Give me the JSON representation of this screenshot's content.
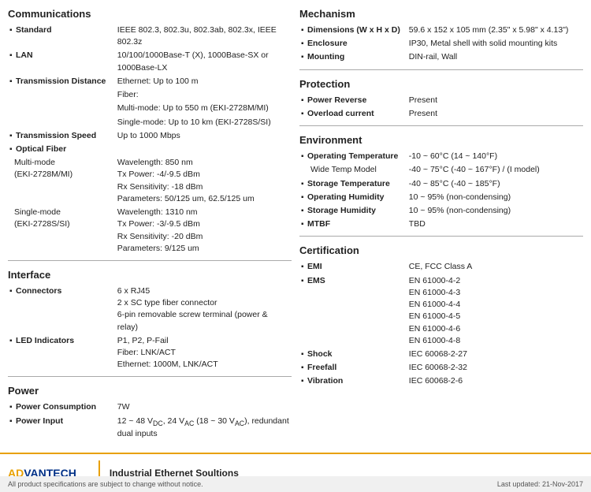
{
  "left": {
    "sections": [
      {
        "title": "Communications",
        "rows": [
          {
            "label": "Standard",
            "bold": true,
            "value": "IEEE 802.3, 802.3u, 802.3ab, 802.3x, IEEE 802.3z",
            "indent": 0
          },
          {
            "label": "LAN",
            "bold": true,
            "value": "10/100/1000Base-T (X), 1000Base-SX or 1000Base-LX",
            "indent": 0
          },
          {
            "label": "Transmission Distance",
            "bold": true,
            "value": "Ethernet: Up to 100 m",
            "indent": 0
          },
          {
            "label": "",
            "bold": false,
            "value": "Fiber:",
            "indent": 0
          },
          {
            "label": "",
            "bold": false,
            "value": "Multi-mode: Up to 550 m (EKI-2728M/MI)",
            "indent": 0
          },
          {
            "label": "",
            "bold": false,
            "value": "Single-mode: Up to 10 km (EKI-2728S/SI)",
            "indent": 0
          },
          {
            "label": "Transmission Speed",
            "bold": true,
            "value": "Up to 1000 Mbps",
            "indent": 0
          },
          {
            "label": "Optical Fiber",
            "bold": true,
            "value": "",
            "indent": 0
          },
          {
            "label": "Multi-mode",
            "bold": false,
            "value": "Wavelength: 850 nm",
            "indent": 1
          },
          {
            "label": "(EKI-2728M/MI)",
            "bold": false,
            "value": "Tx Power: -4/-9.5 dBm",
            "indent": 1
          },
          {
            "label": "",
            "bold": false,
            "value": "Rx Sensitivity: -18 dBm",
            "indent": 1
          },
          {
            "label": "",
            "bold": false,
            "value": "Parameters: 50/125 um, 62.5/125 um",
            "indent": 1
          },
          {
            "label": "Single-mode",
            "bold": false,
            "value": "Wavelength: 1310 nm",
            "indent": 1
          },
          {
            "label": "(EKI-2728S/SI)",
            "bold": false,
            "value": "Tx Power: -3/-9.5 dBm",
            "indent": 1
          },
          {
            "label": "",
            "bold": false,
            "value": "Rx Sensitivity: -20 dBm",
            "indent": 1
          },
          {
            "label": "",
            "bold": false,
            "value": "Parameters: 9/125 um",
            "indent": 1
          }
        ]
      },
      {
        "title": "Interface",
        "rows": [
          {
            "label": "Connectors",
            "bold": true,
            "value": "6 x RJ45",
            "indent": 0
          },
          {
            "label": "",
            "bold": false,
            "value": "2 x SC type fiber connector",
            "indent": 0
          },
          {
            "label": "",
            "bold": false,
            "value": "6-pin removable screw terminal (power & relay)",
            "indent": 0
          },
          {
            "label": "LED Indicators",
            "bold": true,
            "value": "P1, P2, P-Fail",
            "indent": 0
          },
          {
            "label": "",
            "bold": false,
            "value": "Fiber: LNK/ACT",
            "indent": 0
          },
          {
            "label": "",
            "bold": false,
            "value": "Ethernet: 1000M, LNK/ACT",
            "indent": 0
          }
        ]
      },
      {
        "title": "Power",
        "rows": [
          {
            "label": "Power Consumption",
            "bold": true,
            "value": "7W",
            "indent": 0
          },
          {
            "label": "Power Input",
            "bold": true,
            "value": "12 ~ 48 VDC, 24 VAC (18 ~ 30 VAC), redundant dual inputs",
            "indent": 0
          }
        ]
      }
    ]
  },
  "right": {
    "sections": [
      {
        "title": "Mechanism",
        "rows": [
          {
            "label": "Dimensions (W x H x D)",
            "bold": true,
            "value": "59.6 x 152 x 105 mm (2.35\" x 5.98\" x 4.13\")",
            "indent": 0
          },
          {
            "label": "Enclosure",
            "bold": true,
            "value": "IP30, Metal shell with solid mounting kits",
            "indent": 0
          },
          {
            "label": "Mounting",
            "bold": true,
            "value": "DIN-rail, Wall",
            "indent": 0
          }
        ]
      },
      {
        "title": "Protection",
        "rows": [
          {
            "label": "Power Reverse",
            "bold": true,
            "value": "Present",
            "indent": 0
          },
          {
            "label": "Overload current",
            "bold": true,
            "value": "Present",
            "indent": 0
          }
        ]
      },
      {
        "title": "Environment",
        "rows": [
          {
            "label": "Operating Temperature",
            "bold": true,
            "value": "-10 ~ 60°C (14 ~ 140°F)",
            "indent": 0
          },
          {
            "label": "Wide Temp Model",
            "bold": false,
            "value": "-40 ~ 75°C (-40 ~ 167°F) / (I model)",
            "indent": 1
          },
          {
            "label": "Storage Temperature",
            "bold": true,
            "value": "-40 ~ 85°C (-40 ~ 185°F)",
            "indent": 0
          },
          {
            "label": "Operating Humidity",
            "bold": true,
            "value": "10 ~ 95% (non-condensing)",
            "indent": 0
          },
          {
            "label": "Storage Humidity",
            "bold": true,
            "value": "10 ~ 95% (non-condensing)",
            "indent": 0
          },
          {
            "label": "MTBF",
            "bold": true,
            "value": "TBD",
            "indent": 0
          }
        ]
      },
      {
        "title": "Certification",
        "rows": [
          {
            "label": "EMI",
            "bold": true,
            "value": "CE, FCC Class A",
            "indent": 0
          },
          {
            "label": "EMS",
            "bold": true,
            "value": "EN 61000-4-2",
            "indent": 0
          },
          {
            "label": "",
            "bold": false,
            "value": "EN 61000-4-3",
            "indent": 0
          },
          {
            "label": "",
            "bold": false,
            "value": "EN 61000-4-4",
            "indent": 0
          },
          {
            "label": "",
            "bold": false,
            "value": "EN 61000-4-5",
            "indent": 0
          },
          {
            "label": "",
            "bold": false,
            "value": "EN 61000-4-6",
            "indent": 0
          },
          {
            "label": "",
            "bold": false,
            "value": "EN 61000-4-8",
            "indent": 0
          },
          {
            "label": "Shock",
            "bold": true,
            "value": "IEC 60068-2-27",
            "indent": 0
          },
          {
            "label": "Freefall",
            "bold": true,
            "value": "IEC 60068-2-32",
            "indent": 0
          },
          {
            "label": "Vibration",
            "bold": true,
            "value": "IEC 60068-2-6",
            "indent": 0
          }
        ]
      }
    ]
  },
  "footer": {
    "logo_adv": "AD",
    "logo_vantech": "ANTECH",
    "tagline": "Industrial Ethernet Soultions",
    "disclaimer": "All product specifications are subject to change without notice.",
    "last_updated": "Last updated: 21-Nov-2017"
  }
}
